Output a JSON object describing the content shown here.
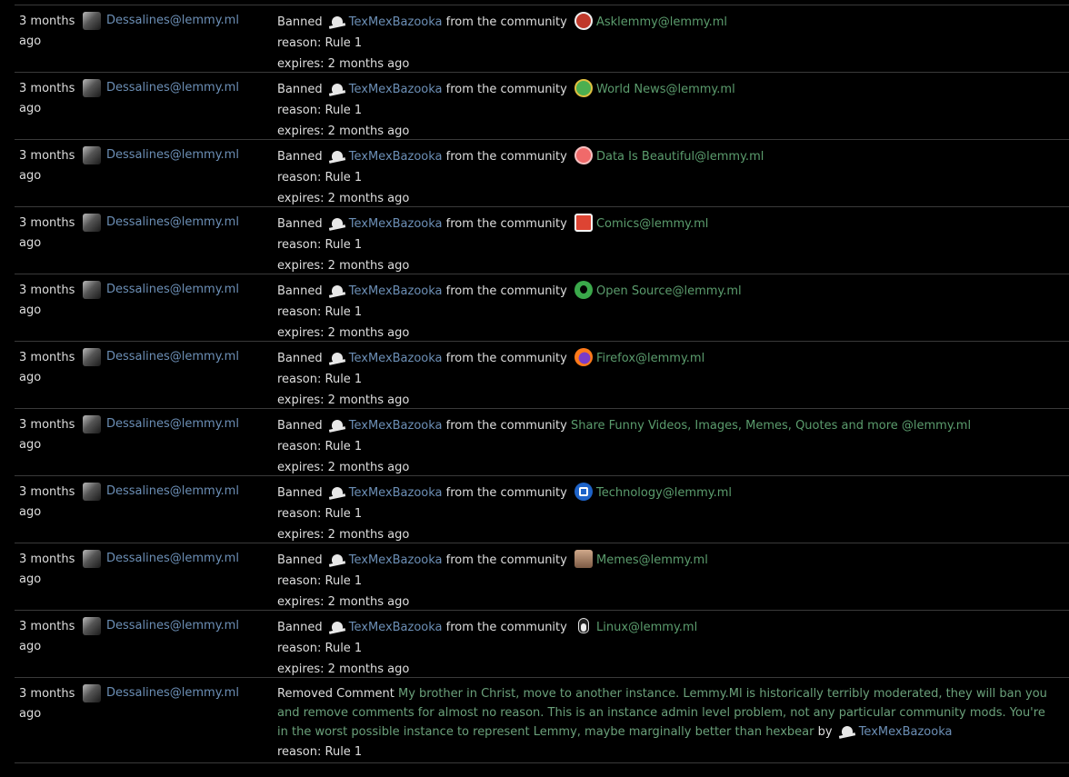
{
  "rows": [
    {
      "time_1": "3 months",
      "time_2": "ago",
      "moderator": "Dessalines@lemmy.ml",
      "action": "Banned",
      "user": "TexMexBazooka",
      "from_text": "from the community",
      "community_icon": "asklemmy-icon",
      "community": "Asklemmy@lemmy.ml",
      "reason": "reason: Rule 1",
      "expires": "expires: 2 months ago"
    },
    {
      "time_1": "3 months",
      "time_2": "ago",
      "moderator": "Dessalines@lemmy.ml",
      "action": "Banned",
      "user": "TexMexBazooka",
      "from_text": "from the community",
      "community_icon": "worldnews-icon",
      "community": "World News@lemmy.ml",
      "reason": "reason: Rule 1",
      "expires": "expires: 2 months ago"
    },
    {
      "time_1": "3 months",
      "time_2": "ago",
      "moderator": "Dessalines@lemmy.ml",
      "action": "Banned",
      "user": "TexMexBazooka",
      "from_text": "from the community",
      "community_icon": "dataisbeautiful-icon",
      "community": "Data Is Beautiful@lemmy.ml",
      "reason": "reason: Rule 1",
      "expires": "expires: 2 months ago"
    },
    {
      "time_1": "3 months",
      "time_2": "ago",
      "moderator": "Dessalines@lemmy.ml",
      "action": "Banned",
      "user": "TexMexBazooka",
      "from_text": "from the community",
      "community_icon": "comics-icon",
      "community": "Comics@lemmy.ml",
      "reason": "reason: Rule 1",
      "expires": "expires: 2 months ago"
    },
    {
      "time_1": "3 months",
      "time_2": "ago",
      "moderator": "Dessalines@lemmy.ml",
      "action": "Banned",
      "user": "TexMexBazooka",
      "from_text": "from the community",
      "community_icon": "opensource-icon",
      "community": "Open Source@lemmy.ml",
      "reason": "reason: Rule 1",
      "expires": "expires: 2 months ago"
    },
    {
      "time_1": "3 months",
      "time_2": "ago",
      "moderator": "Dessalines@lemmy.ml",
      "action": "Banned",
      "user": "TexMexBazooka",
      "from_text": "from the community",
      "community_icon": "firefox-icon",
      "community": "Firefox@lemmy.ml",
      "reason": "reason: Rule 1",
      "expires": "expires: 2 months ago"
    },
    {
      "time_1": "3 months",
      "time_2": "ago",
      "moderator": "Dessalines@lemmy.ml",
      "action": "Banned",
      "user": "TexMexBazooka",
      "from_text": "from the community",
      "community_icon": "",
      "community": "Share Funny Videos, Images, Memes, Quotes and more @lemmy.ml",
      "reason": "reason: Rule 1",
      "expires": "expires: 2 months ago"
    },
    {
      "time_1": "3 months",
      "time_2": "ago",
      "moderator": "Dessalines@lemmy.ml",
      "action": "Banned",
      "user": "TexMexBazooka",
      "from_text": "from the community",
      "community_icon": "technology-icon",
      "community": "Technology@lemmy.ml",
      "reason": "reason: Rule 1",
      "expires": "expires: 2 months ago"
    },
    {
      "time_1": "3 months",
      "time_2": "ago",
      "moderator": "Dessalines@lemmy.ml",
      "action": "Banned",
      "user": "TexMexBazooka",
      "from_text": "from the community",
      "community_icon": "memes-icon",
      "community": "Memes@lemmy.ml",
      "reason": "reason: Rule 1",
      "expires": "expires: 2 months ago"
    },
    {
      "time_1": "3 months",
      "time_2": "ago",
      "moderator": "Dessalines@lemmy.ml",
      "action": "Banned",
      "user": "TexMexBazooka",
      "from_text": "from the community",
      "community_icon": "linux-icon",
      "community": "Linux@lemmy.ml",
      "reason": "reason: Rule 1",
      "expires": "expires: 2 months ago"
    }
  ],
  "removed_comment": {
    "time_1": "3 months",
    "time_2": "ago",
    "moderator": "Dessalines@lemmy.ml",
    "action": "Removed Comment",
    "comment": "My brother in Christ, move to another instance. Lemmy.Ml is historically terribly moderated, they will ban you and remove comments for almost no reason. This is an instance admin level problem, not any particular community mods. You're in the worst possible instance to represent Lemmy, maybe marginally better than hexbear",
    "by_text": "by",
    "user": "TexMexBazooka",
    "reason": "reason: Rule 1"
  },
  "colors": {
    "background": "#000000",
    "user_link": "#6c8fb6",
    "community_link": "#5b9c6d",
    "text": "#dedede"
  }
}
